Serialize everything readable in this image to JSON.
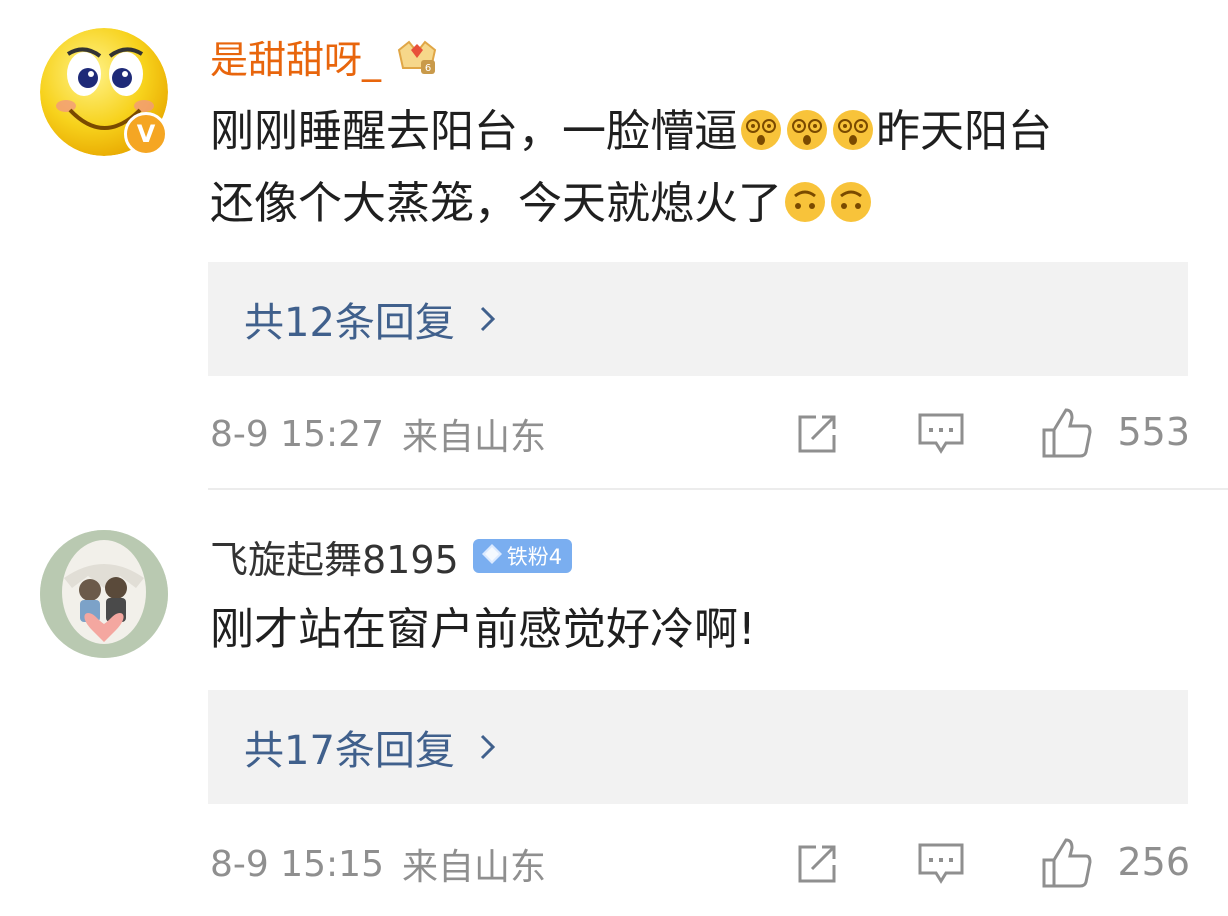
{
  "comments": [
    {
      "username": "是甜甜呀_",
      "verified_badge": "V",
      "text_parts": [
        "刚刚睡醒去阳台，一脸懵逼",
        "昨天阳台",
        "还像个大蒸笼，今天就熄火了"
      ],
      "replies_label": "共12条回复",
      "time": "8-9 15:27",
      "location": "来自山东",
      "likes": "553",
      "icons": {
        "avatar": "cartoon-smiley-avatar",
        "badge": "crown-badge",
        "emoji_1": "dizzy-face-emoji",
        "emoji_2": "upside-down-face-emoji"
      }
    },
    {
      "username": "飞旋起舞8195",
      "fan_badge": "铁粉4",
      "text": "刚才站在窗户前感觉好冷啊!",
      "replies_label": "共17条回复",
      "time": "8-9 15:15",
      "location": "来自山东",
      "likes": "256",
      "icons": {
        "avatar": "photo-avatar",
        "badge": "diamond-icon"
      }
    }
  ],
  "colors": {
    "vip_name": "#e8650c",
    "reply_link": "#40608c",
    "meta_gray": "#8f8f8f",
    "reply_bg": "#f2f2f2",
    "fan_badge": "#7aaef0"
  }
}
